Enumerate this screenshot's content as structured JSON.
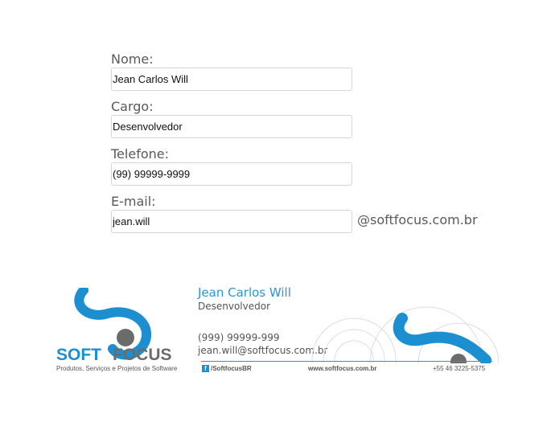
{
  "form": {
    "nome_label": "Nome:",
    "nome_value": "Jean Carlos Will",
    "cargo_label": "Cargo:",
    "cargo_value": "Desenvolvedor",
    "telefone_label": "Telefone:",
    "telefone_value": "(99) 99999-9999",
    "email_label": "E-mail:",
    "email_value": "jean.will",
    "email_domain": "@softfocus.com.br"
  },
  "signature": {
    "name": "Jean Carlos Will",
    "role": "Desenvolvedor",
    "phone": "(999) 99999-999",
    "email": "jean.will@softfocus.com.br",
    "brand_soft": "SOFT",
    "brand_focus": "FOCUS",
    "tagline": "Produtos, Serviços e Projetos de Software",
    "facebook_icon": "f",
    "facebook": "/SoftfocusBR",
    "website": "www.softfocus.com.br",
    "footer_phone": "+55 46 3225-5375"
  },
  "colors": {
    "brand_blue": "#1c8fd0",
    "brand_gray": "#6b6b6b",
    "label_gray": "#595959"
  },
  "icons": {
    "logo": "softfocus-logo-icon",
    "facebook": "facebook-icon",
    "decoration": "softfocus-swirl-icon"
  }
}
